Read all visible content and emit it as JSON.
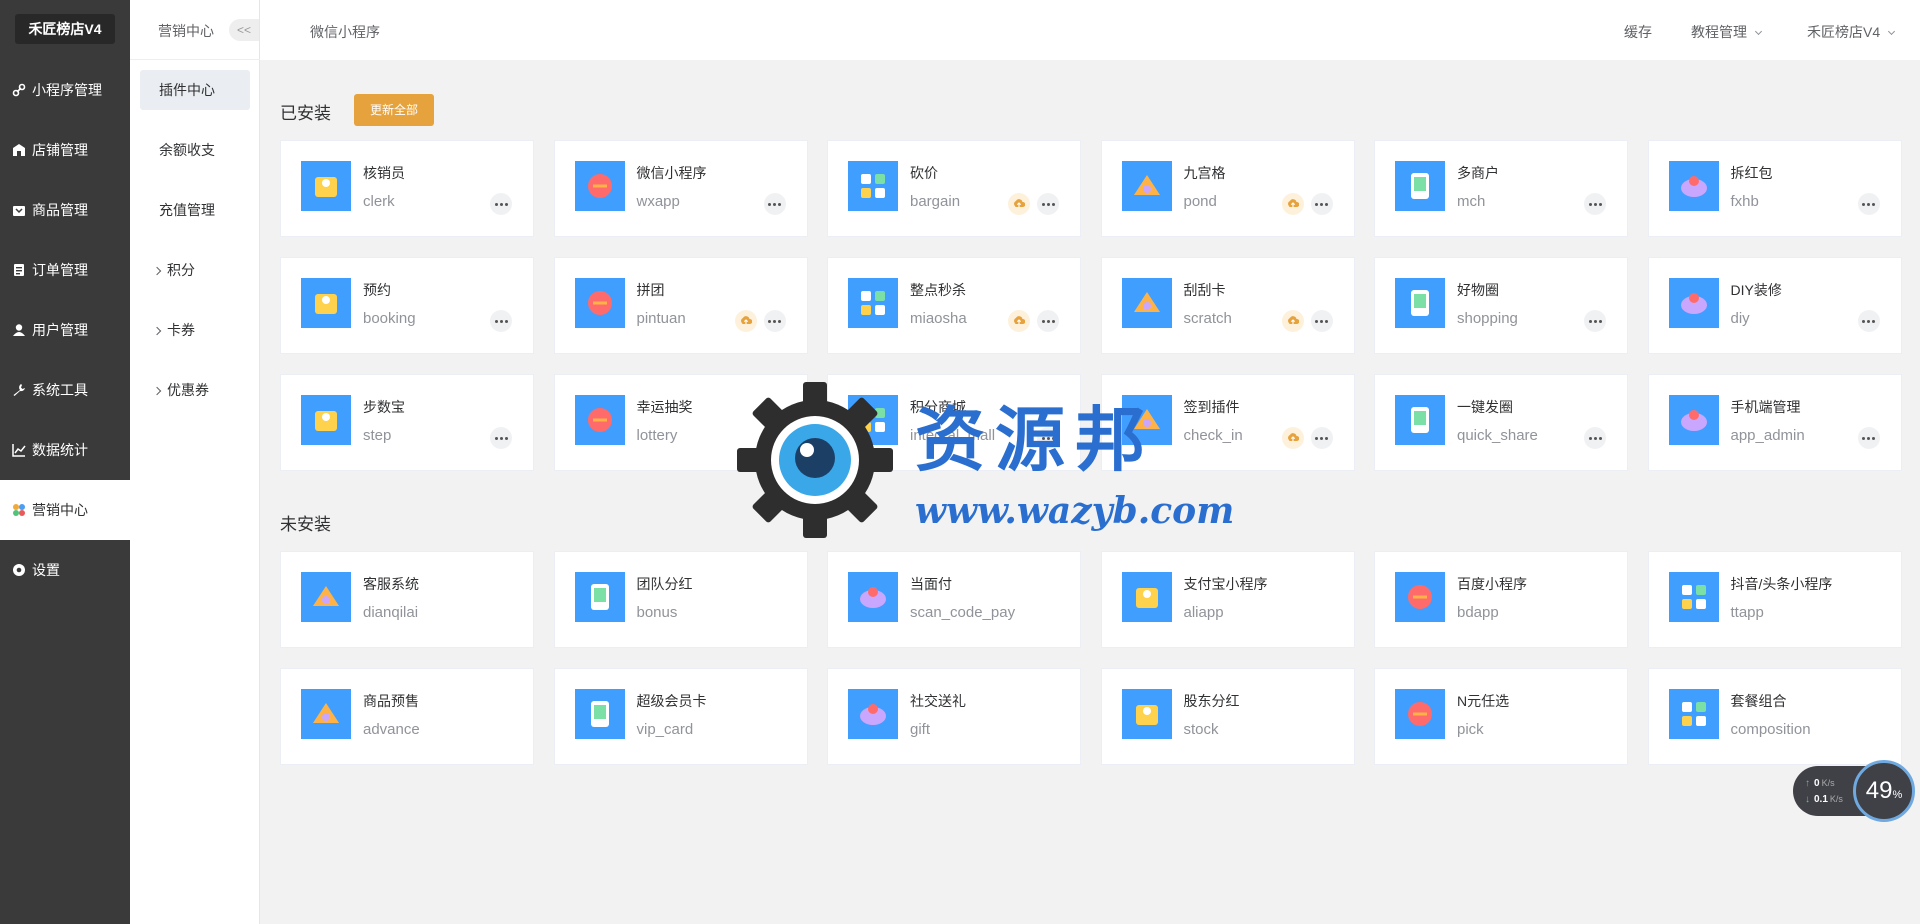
{
  "brand": "禾匠榜店V4",
  "nav": [
    {
      "label": "小程序管理",
      "icon": "link-icon",
      "active": false
    },
    {
      "label": "店铺管理",
      "icon": "store-icon",
      "active": false
    },
    {
      "label": "商品管理",
      "icon": "goods-icon",
      "active": false
    },
    {
      "label": "订单管理",
      "icon": "order-icon",
      "active": false
    },
    {
      "label": "用户管理",
      "icon": "user-icon",
      "active": false
    },
    {
      "label": "系统工具",
      "icon": "wrench-icon",
      "active": false
    },
    {
      "label": "数据统计",
      "icon": "chart-icon",
      "active": false
    },
    {
      "label": "营销中心",
      "icon": "marketing-icon",
      "active": true
    },
    {
      "label": "设置",
      "icon": "settings-icon",
      "active": false
    }
  ],
  "submenu": {
    "title": "营销中心",
    "collapse_label": "<<",
    "items": [
      "插件中心",
      "余额收支",
      "充值管理"
    ],
    "groups": [
      "积分",
      "卡券",
      "优惠券"
    ]
  },
  "topbar": {
    "breadcrumb": "微信小程序",
    "cache": "缓存",
    "tutorial": "教程管理",
    "account": "禾匠榜店V4"
  },
  "installed": {
    "title": "已安装",
    "update_all": "更新全部",
    "plugins": [
      {
        "name": "核销员",
        "key": "clerk",
        "icon": "clerk-icon",
        "update": false
      },
      {
        "name": "微信小程序",
        "key": "wxapp",
        "icon": "wxapp-icon",
        "update": false
      },
      {
        "name": "砍价",
        "key": "bargain",
        "icon": "bargain-icon",
        "update": true
      },
      {
        "name": "九宫格",
        "key": "pond",
        "icon": "pond-icon",
        "update": true
      },
      {
        "name": "多商户",
        "key": "mch",
        "icon": "mch-icon",
        "update": false
      },
      {
        "name": "拆红包",
        "key": "fxhb",
        "icon": "red-packet-icon",
        "update": false
      },
      {
        "name": "预约",
        "key": "booking",
        "icon": "booking-icon",
        "update": false
      },
      {
        "name": "拼团",
        "key": "pintuan",
        "icon": "pintuan-icon",
        "update": true
      },
      {
        "name": "整点秒杀",
        "key": "miaosha",
        "icon": "miaosha-icon",
        "update": true
      },
      {
        "name": "刮刮卡",
        "key": "scratch",
        "icon": "scratch-icon",
        "update": true
      },
      {
        "name": "好物圈",
        "key": "shopping",
        "icon": "shopping-icon",
        "update": false
      },
      {
        "name": "DIY装修",
        "key": "diy",
        "icon": "diy-icon",
        "update": false
      },
      {
        "name": "步数宝",
        "key": "step",
        "icon": "step-icon",
        "update": false
      },
      {
        "name": "幸运抽奖",
        "key": "lottery",
        "icon": "lottery-icon",
        "update": false
      },
      {
        "name": "积分商城",
        "key": "integral_mall",
        "icon": "integral-mall-icon",
        "update": false
      },
      {
        "name": "签到插件",
        "key": "check_in",
        "icon": "check-in-icon",
        "update": true
      },
      {
        "name": "一键发圈",
        "key": "quick_share",
        "icon": "quick-share-icon",
        "update": false
      },
      {
        "name": "手机端管理",
        "key": "app_admin",
        "icon": "app-admin-icon",
        "update": false
      }
    ]
  },
  "uninstalled": {
    "title": "未安装",
    "plugins": [
      {
        "name": "客服系统",
        "key": "dianqilai",
        "icon": "customer-service-icon"
      },
      {
        "name": "团队分红",
        "key": "bonus",
        "icon": "bonus-icon"
      },
      {
        "name": "当面付",
        "key": "scan_code_pay",
        "icon": "scan-pay-icon"
      },
      {
        "name": "支付宝小程序",
        "key": "aliapp",
        "icon": "aliapp-icon"
      },
      {
        "name": "百度小程序",
        "key": "bdapp",
        "icon": "bdapp-icon"
      },
      {
        "name": "抖音/头条小程序",
        "key": "ttapp",
        "icon": "ttapp-icon"
      },
      {
        "name": "商品预售",
        "key": "advance",
        "icon": "advance-icon"
      },
      {
        "name": "超级会员卡",
        "key": "vip_card",
        "icon": "vip-card-icon"
      },
      {
        "name": "社交送礼",
        "key": "gift",
        "icon": "gift-icon"
      },
      {
        "name": "股东分红",
        "key": "stock",
        "icon": "stock-icon"
      },
      {
        "name": "N元任选",
        "key": "pick",
        "icon": "pick-icon"
      },
      {
        "name": "套餐组合",
        "key": "composition",
        "icon": "composition-icon"
      }
    ]
  },
  "watermark": {
    "title": "资源邦",
    "url": "www.wazyb.com"
  },
  "speed": {
    "up": "0",
    "down": "0.1",
    "unit": "K/s",
    "percent": "49",
    "percent_sign": "%"
  },
  "colors": {
    "sidebar": "#3a3a3a",
    "accent": "#409eff",
    "warning": "#e6a23c"
  }
}
